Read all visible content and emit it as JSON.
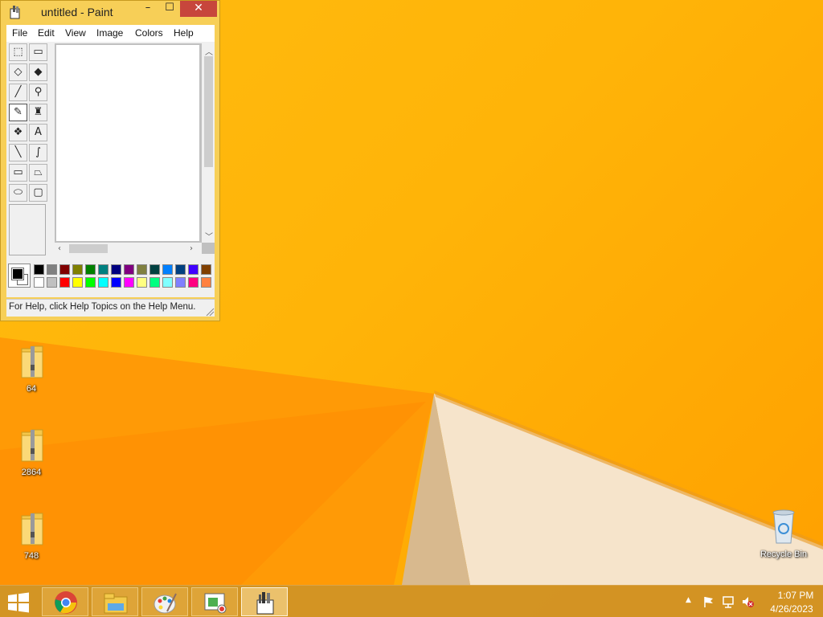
{
  "window": {
    "title": "untitled - Paint",
    "minimize": "–",
    "maximize": "☐",
    "close": "✕"
  },
  "menu": [
    "File",
    "Edit",
    "View",
    "Image",
    "Colors",
    "Help"
  ],
  "tools": [
    {
      "name": "free-form-select-icon",
      "glyph": "⬚"
    },
    {
      "name": "select-icon",
      "glyph": "▭"
    },
    {
      "name": "eraser-icon",
      "glyph": "◇"
    },
    {
      "name": "fill-icon",
      "glyph": "◆"
    },
    {
      "name": "pick-color-icon",
      "glyph": "╱"
    },
    {
      "name": "magnifier-icon",
      "glyph": "⚲"
    },
    {
      "name": "pencil-icon",
      "glyph": "✎"
    },
    {
      "name": "brush-icon",
      "glyph": "♜"
    },
    {
      "name": "airbrush-icon",
      "glyph": "❖"
    },
    {
      "name": "text-icon",
      "glyph": "A"
    },
    {
      "name": "line-icon",
      "glyph": "╲"
    },
    {
      "name": "curve-icon",
      "glyph": "∫"
    },
    {
      "name": "rectangle-icon",
      "glyph": "▭"
    },
    {
      "name": "polygon-icon",
      "glyph": "⏢"
    },
    {
      "name": "ellipse-icon",
      "glyph": "⬭"
    },
    {
      "name": "rounded-rectangle-icon",
      "glyph": "▢"
    }
  ],
  "selected_tool": "pencil-icon",
  "palette": {
    "foreground": "#000000",
    "background": "#ffffff",
    "top_row": [
      "#000000",
      "#808080",
      "#800000",
      "#808000",
      "#008000",
      "#008080",
      "#000080",
      "#800080",
      "#808040",
      "#004040",
      "#0080ff",
      "#004080",
      "#4000ff",
      "#804000"
    ],
    "bottom_row": [
      "#ffffff",
      "#c0c0c0",
      "#ff0000",
      "#ffff00",
      "#00ff00",
      "#00ffff",
      "#0000ff",
      "#ff00ff",
      "#ffff80",
      "#00ff80",
      "#80ffff",
      "#8080ff",
      "#ff0080",
      "#ff8040"
    ]
  },
  "status": "For Help, click Help Topics on the Help Menu.",
  "desktop_icons": [
    {
      "label": "64"
    },
    {
      "label": "2864"
    },
    {
      "label": "748"
    },
    {
      "label": "Recycle Bin"
    }
  ],
  "taskbar": {
    "items": [
      "start-button",
      "chrome-icon",
      "file-explorer-icon",
      "paint-palette-icon",
      "recorder-icon",
      "paint-icon"
    ],
    "time": "1:07 PM",
    "date": "4/26/2023"
  }
}
